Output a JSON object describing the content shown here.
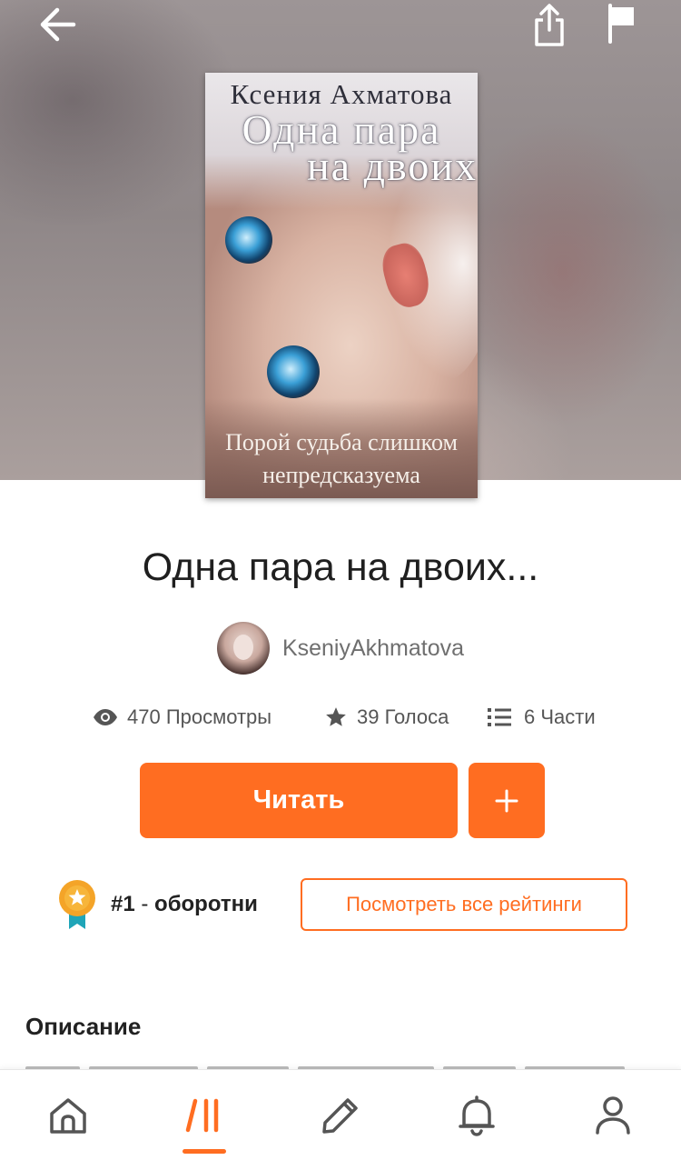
{
  "header": {
    "back_icon": "arrow-left-icon",
    "share_icon": "share-icon",
    "report_icon": "flag-icon"
  },
  "cover": {
    "author": "Ксения Ахматова",
    "title_line1": "Одна пара",
    "title_line2": "на двоих",
    "tagline_line1": "Порой судьба слишком",
    "tagline_line2": "непредсказуема"
  },
  "story": {
    "title": "Одна пара на двоих...",
    "author_username": "KseniyAkhmatova"
  },
  "stats": {
    "views": "470 Просмотры",
    "votes": "39 Голоса",
    "parts": "6 Части"
  },
  "actions": {
    "read_label": "Читать",
    "add_label": "+"
  },
  "ranking": {
    "rank": "#1",
    "separator": " - ",
    "tag": "оборотни",
    "view_all_label": "Посмотреть все рейтинги"
  },
  "description": {
    "heading": "Описание"
  },
  "nav": {
    "items": [
      "home-icon",
      "library-icon",
      "write-icon",
      "notifications-icon",
      "profile-icon"
    ],
    "active_index": 1
  },
  "colors": {
    "accent": "#ff6d21",
    "text": "#222222",
    "muted": "#6f6f6f"
  }
}
